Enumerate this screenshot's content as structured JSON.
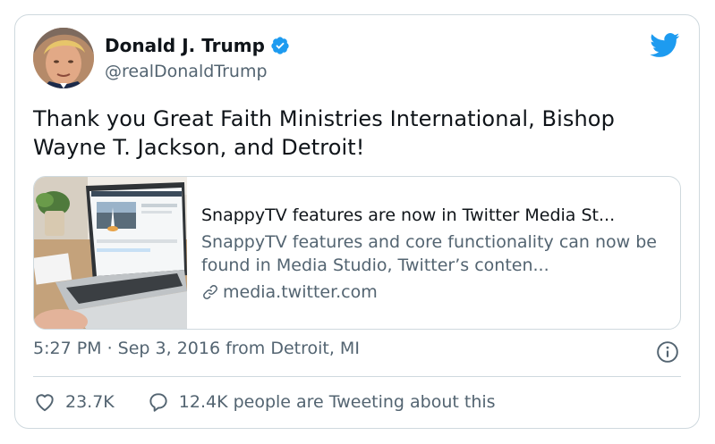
{
  "author": {
    "display_name": "Donald J. Trump",
    "handle": "@realDonaldTrump",
    "verified": true
  },
  "tweet": {
    "text": "Thank you Great Faith Ministries International, Bishop Wayne T. Jackson, and Detroit!"
  },
  "link_card": {
    "title": "SnappyTV features are now in Twitter Media St...",
    "description": "SnappyTV features and core functionality can now be found in Media Studio, Twitter’s conten...",
    "domain": "media.twitter.com",
    "icon": "link-icon"
  },
  "meta": {
    "timestamp": "5:27 PM · Sep 3, 2016 from Detroit, MI"
  },
  "actions": {
    "likes": "23.7K",
    "tweeting": "12.4K people are Tweeting about this"
  },
  "colors": {
    "brand": "#1d9bf0",
    "text_primary": "#0f1419",
    "text_secondary": "#536471",
    "border": "#cfd9de"
  }
}
